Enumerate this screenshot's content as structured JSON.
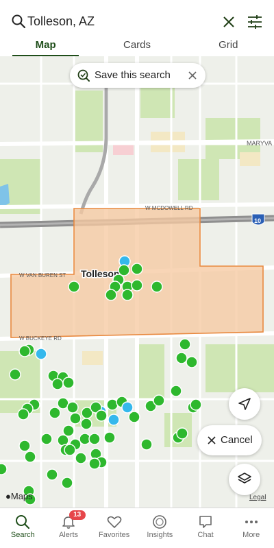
{
  "search": {
    "value": "Tolleson, AZ"
  },
  "tabs": [
    {
      "label": "Map",
      "active": true
    },
    {
      "label": "Cards",
      "active": false
    },
    {
      "label": "Grid",
      "active": false
    }
  ],
  "map": {
    "save_search_label": "Save this search",
    "cancel_label": "Cancel",
    "place_label": "Tolleson",
    "road_labels": {
      "mcdowell": "W MCDOWELL RD",
      "van_buren": "W VAN BUREN ST",
      "buckeye": "W BUCKEYE RD",
      "maryvale": "MARYVA",
      "i10": "10"
    },
    "attribution": "Maps",
    "legal": "Legal",
    "colors": {
      "listing": "#2eb82e",
      "viewed": "#35b8ec",
      "search_area": "#f6c9a1",
      "search_border": "#e8893f"
    }
  },
  "bottom_nav": [
    {
      "label": "Search",
      "icon": "search-icon",
      "active": true
    },
    {
      "label": "Alerts",
      "icon": "bell-icon",
      "badge": "13"
    },
    {
      "label": "Favorites",
      "icon": "heart-icon"
    },
    {
      "label": "Insights",
      "icon": "insights-icon"
    },
    {
      "label": "Chat",
      "icon": "chat-icon"
    },
    {
      "label": "More",
      "icon": "more-icon"
    }
  ]
}
